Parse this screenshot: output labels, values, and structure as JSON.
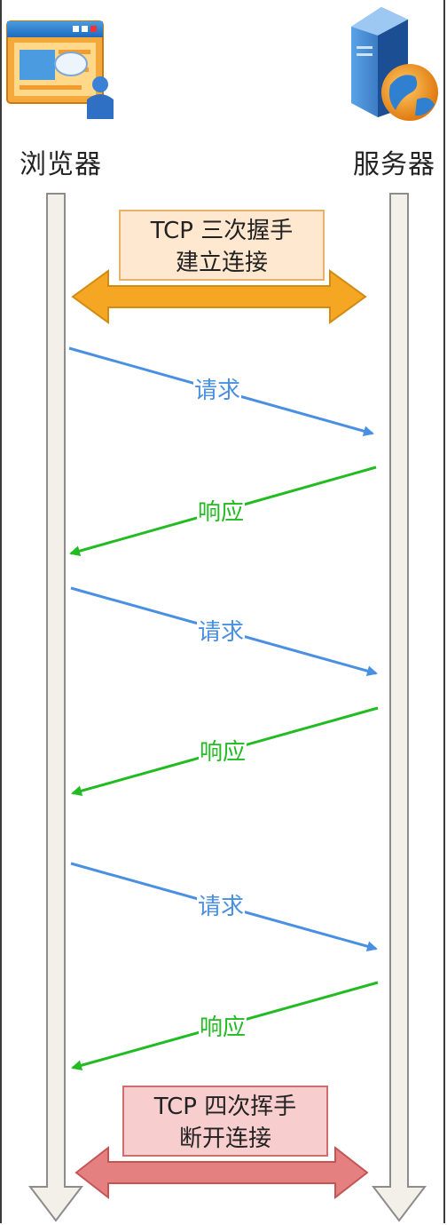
{
  "participants": {
    "browser": {
      "label": "浏览器",
      "icon": "browser-window-icon"
    },
    "server": {
      "label": "服务器",
      "icon": "server-globe-icon"
    }
  },
  "handshake": {
    "line1": "TCP 三次握手",
    "line2": "建立连接"
  },
  "teardown": {
    "line1": "TCP 四次挥手",
    "line2": "断开连接"
  },
  "messages": [
    {
      "label": "请求",
      "direction": "browser-to-server"
    },
    {
      "label": "响应",
      "direction": "server-to-browser"
    },
    {
      "label": "请求",
      "direction": "browser-to-server"
    },
    {
      "label": "响应",
      "direction": "server-to-browser"
    },
    {
      "label": "请求",
      "direction": "browser-to-server"
    },
    {
      "label": "响应",
      "direction": "server-to-browser"
    }
  ],
  "colors": {
    "request": "#4a90e2",
    "response": "#22bb22",
    "open_fill": "#ffe8cf",
    "open_arrow": "#f5a623",
    "close_fill": "#f8cdcd",
    "close_arrow": "#e58080",
    "lifeline": "#f3f0ea"
  }
}
